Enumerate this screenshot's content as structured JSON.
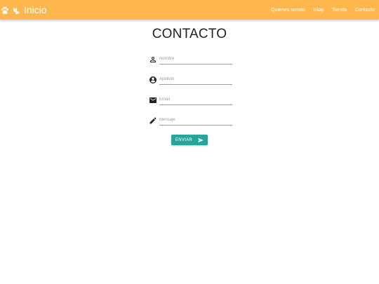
{
  "navbar": {
    "brand_label": "Inicio",
    "brand_icons": [
      "paw-icon",
      "cat-icon"
    ],
    "links": [
      {
        "label": "Quienes somos"
      },
      {
        "label": "Blog"
      },
      {
        "label": "Tienda"
      },
      {
        "label": "Contacto"
      }
    ]
  },
  "page": {
    "title": "CONTACTO"
  },
  "form": {
    "fields": [
      {
        "icon": "person-outline-icon",
        "placeholder": "Nombre",
        "value": ""
      },
      {
        "icon": "account-circle-icon",
        "placeholder": "Apellido",
        "value": ""
      },
      {
        "icon": "email-icon",
        "placeholder": "Email",
        "value": ""
      },
      {
        "icon": "pencil-icon",
        "placeholder": "Mensaje",
        "value": ""
      }
    ],
    "submit_label": "ENVIAR",
    "submit_icon": "send-icon"
  },
  "colors": {
    "navbar": "#ffb74d",
    "button": "#26a69a",
    "text": "#212121"
  }
}
